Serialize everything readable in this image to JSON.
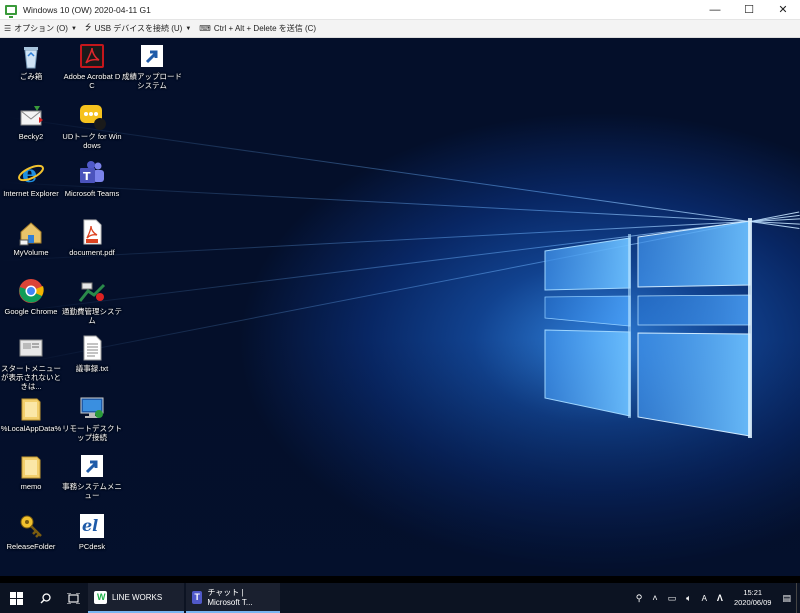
{
  "window": {
    "title": "Windows 10 (OW) 2020-04-11 G1",
    "minimize": "—",
    "maximize": "☐",
    "close": "✕"
  },
  "toolbar": {
    "options": "オプション (O)",
    "usb": "USB デバイスを接続 (U)",
    "cad": "Ctrl + Alt + Delete を送信 (C)"
  },
  "desktop_icons": [
    {
      "label": "ごみ箱",
      "icon": "recycle-bin-icon"
    },
    {
      "label": "Adobe Acrobat DC",
      "icon": "acrobat-icon"
    },
    {
      "label": "成績アップロードシステム",
      "icon": "shortcut-icon"
    },
    {
      "label": "Becky2",
      "icon": "becky-mail-icon"
    },
    {
      "label": "UDトーク for Windows",
      "icon": "udtalk-icon"
    },
    {
      "label": "Internet Explorer",
      "icon": "internet-explorer-icon"
    },
    {
      "label": "Microsoft Teams",
      "icon": "teams-icon"
    },
    {
      "label": "MyVolume",
      "icon": "home-folder-icon"
    },
    {
      "label": "document.pdf",
      "icon": "pdf-file-icon"
    },
    {
      "label": "Google Chrome",
      "icon": "chrome-icon"
    },
    {
      "label": "通勤費管理システム",
      "icon": "commute-system-icon"
    },
    {
      "label": "スタートメニューが表示されないときは...",
      "icon": "startmenu-help-icon"
    },
    {
      "label": "議事録.txt",
      "icon": "text-file-icon"
    },
    {
      "label": "%LocalAppData%",
      "icon": "folder-icon"
    },
    {
      "label": "リモートデスクトップ接続",
      "icon": "remote-desktop-icon"
    },
    {
      "label": "memo",
      "icon": "folder-icon"
    },
    {
      "label": "事務システムメニュー",
      "icon": "shortcut-icon"
    },
    {
      "label": "ReleaseFolder",
      "icon": "release-folder-icon"
    },
    {
      "label": "PCdesk",
      "icon": "pcdesk-icon"
    }
  ],
  "taskbar": {
    "apps": [
      {
        "label": "LINE WORKS",
        "icon": "line-works-icon"
      },
      {
        "label": "チャット | Microsoft T...",
        "icon": "teams-icon"
      }
    ],
    "time": "15:21",
    "date": "2020/06/09"
  },
  "colors": {
    "accent": "#79b6f2",
    "taskbar": "#0c1322",
    "desktop_glow": "#2f7fd8"
  }
}
